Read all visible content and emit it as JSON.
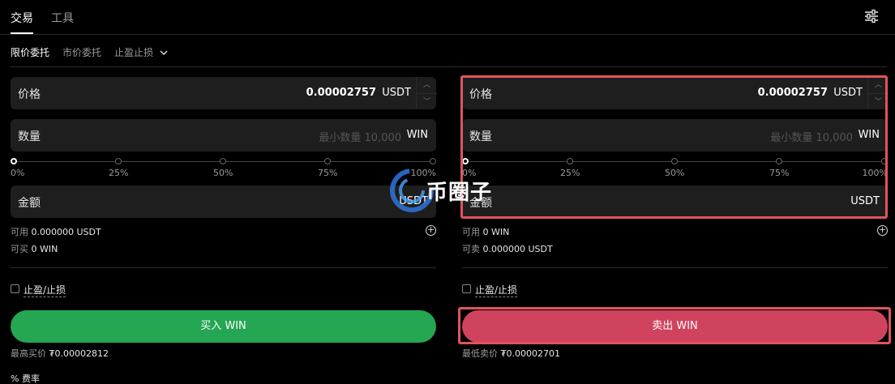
{
  "top_tabs": {
    "trade": "交易",
    "tools": "工具"
  },
  "order_tabs": {
    "limit": "限价委托",
    "market": "市价委托",
    "stop": "止盈止损"
  },
  "help_glyph": "?",
  "slider_marks": [
    "0%",
    "25%",
    "50%",
    "75%",
    "100%"
  ],
  "buy": {
    "price_label": "价格",
    "price_value": "0.00002757",
    "price_unit": "USDT",
    "qty_label": "数量",
    "qty_placeholder": "最小数量 10,000",
    "qty_unit": "WIN",
    "amount_label": "金额",
    "amount_unit": "USDT",
    "avail_label": "可用",
    "avail_value": "0.000000 USDT",
    "can_label": "可买",
    "can_value": "0 WIN",
    "tp_label": "止盈/止损",
    "button_label": "买入 WIN",
    "best_label": "最高买价",
    "best_value": "₮0.00002812"
  },
  "sell": {
    "price_label": "价格",
    "price_value": "0.00002757",
    "price_unit": "USDT",
    "qty_label": "数量",
    "qty_placeholder": "最小数量 10,000",
    "qty_unit": "WIN",
    "amount_label": "金额",
    "amount_unit": "USDT",
    "avail_label": "可用",
    "avail_value": "0 WIN",
    "can_label": "可卖",
    "can_value": "0.000000 USDT",
    "tp_label": "止盈/止损",
    "button_label": "卖出 WIN",
    "best_label": "最低卖价",
    "best_value": "₮0.00002701"
  },
  "fee_label": "% 费率",
  "watermark_text": "币圈子",
  "colors": {
    "buy": "#24a653",
    "sell": "#d0435f",
    "highlight": "#e0555c",
    "field_bg": "#1e1e1e"
  },
  "slider_value": 0
}
